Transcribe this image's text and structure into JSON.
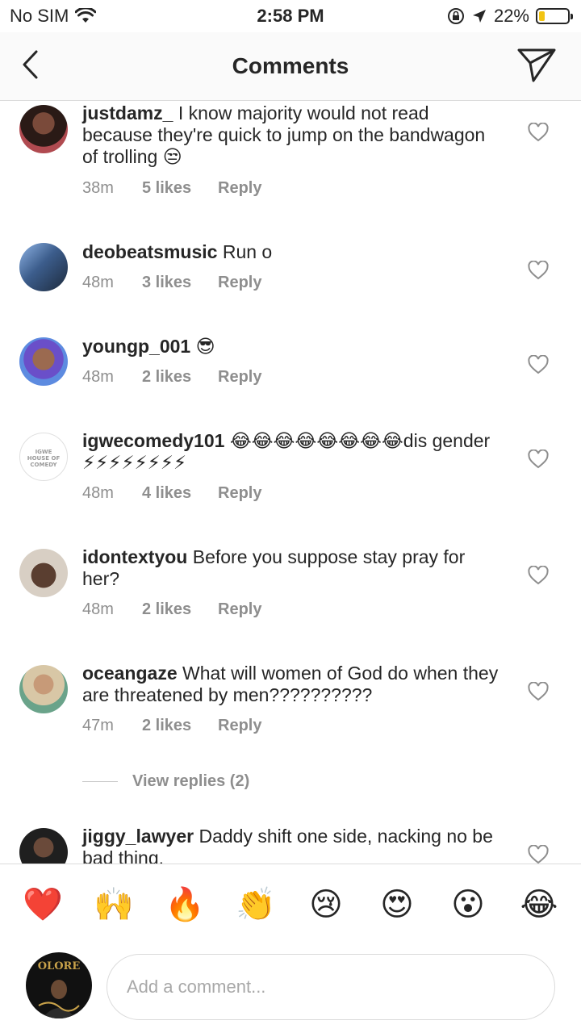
{
  "status": {
    "carrier": "No SIM",
    "time": "2:58 PM",
    "battery_text": "22%",
    "battery_level": 0.22,
    "battery_color": "#f2c413"
  },
  "header": {
    "title": "Comments",
    "back_icon": "chevron-left-icon",
    "send_icon": "paper-plane-icon"
  },
  "comments": [
    {
      "user": "justdamz_",
      "text": "I know majority would not read because they're quick to jump on the bandwagon of trolling 😒",
      "time": "38m",
      "likes": "5 likes",
      "reply": "Reply"
    },
    {
      "user": "deobeatsmusic",
      "text": "Run o",
      "time": "48m",
      "likes": "3 likes",
      "reply": "Reply"
    },
    {
      "user": "youngp_001",
      "text": "😎",
      "time": "48m",
      "likes": "2 likes",
      "reply": "Reply"
    },
    {
      "user": "igwecomedy101",
      "text": "😂😂😂😂😂😂😂😂dis gender ⚡⚡⚡⚡⚡⚡⚡⚡",
      "time": "48m",
      "likes": "4 likes",
      "reply": "Reply",
      "avatar_text": "IGWE HOUSE OF COMEDY"
    },
    {
      "user": "idontextyou",
      "text": "Before you suppose stay pray for her?",
      "time": "48m",
      "likes": "2 likes",
      "reply": "Reply"
    },
    {
      "user": "oceangaze",
      "text": "What will women of God do when they are threatened by men??????????",
      "time": "47m",
      "likes": "2 likes",
      "reply": "Reply"
    },
    {
      "user": "jiggy_lawyer",
      "text": "Daddy shift one side, nacking no be bad thing.",
      "time": "",
      "likes": "",
      "reply": ""
    }
  ],
  "view_replies": "View replies (2)",
  "emojis": [
    "❤️",
    "🙌",
    "🔥",
    "👏",
    "😢",
    "😍",
    "😮",
    "😂"
  ],
  "input": {
    "placeholder": "Add a comment...",
    "value": "",
    "avatar_text": "OLORE"
  }
}
